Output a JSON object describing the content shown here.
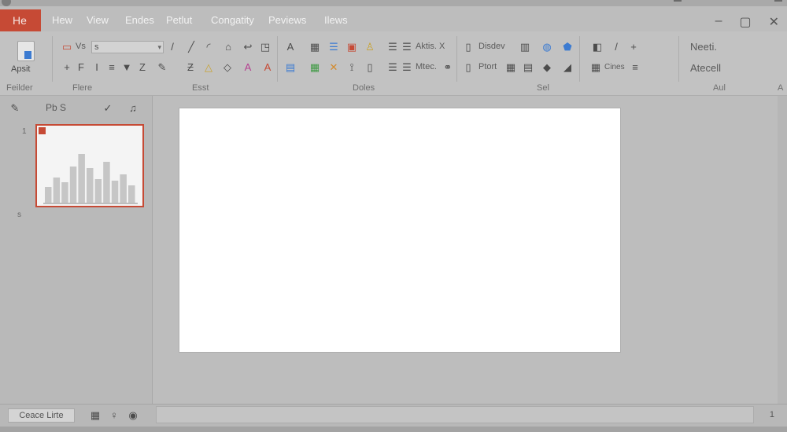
{
  "menu": {
    "file": "He",
    "tabs": [
      "Hew",
      "View",
      "Endes",
      "Petlut",
      "Congatity",
      "Peviews",
      "Ilews"
    ]
  },
  "ribbon": {
    "paste_label": "Apsit",
    "combo_value": "s",
    "combo_prefix": "Vs",
    "groups": [
      "Feilder",
      "Flere",
      "Esst",
      "Doles",
      "Sel",
      "Aul"
    ],
    "align_1": "Aktis. X",
    "align_2": "Mtec.",
    "display_1": "Disdev",
    "display_2": "Ptort",
    "cines": "Cines",
    "right_1": "Neeti.",
    "right_2": "Atecell",
    "corner": "A"
  },
  "slides_pane": {
    "title": "Pb S",
    "first_num": "1",
    "second_num": "s"
  },
  "thumbnail": {
    "bars": [
      0.2,
      0.32,
      0.26,
      0.46,
      0.62,
      0.44,
      0.3,
      0.52,
      0.28,
      0.36,
      0.22
    ],
    "bar_color": "#c6c6c6",
    "accent": "#c64a35"
  },
  "statusbar": {
    "button": "Ceace Lirte",
    "page": "1"
  },
  "colors": {
    "accent": "#c64a35",
    "canvas": "#ffffff",
    "chrome": "#bcbcbc"
  }
}
